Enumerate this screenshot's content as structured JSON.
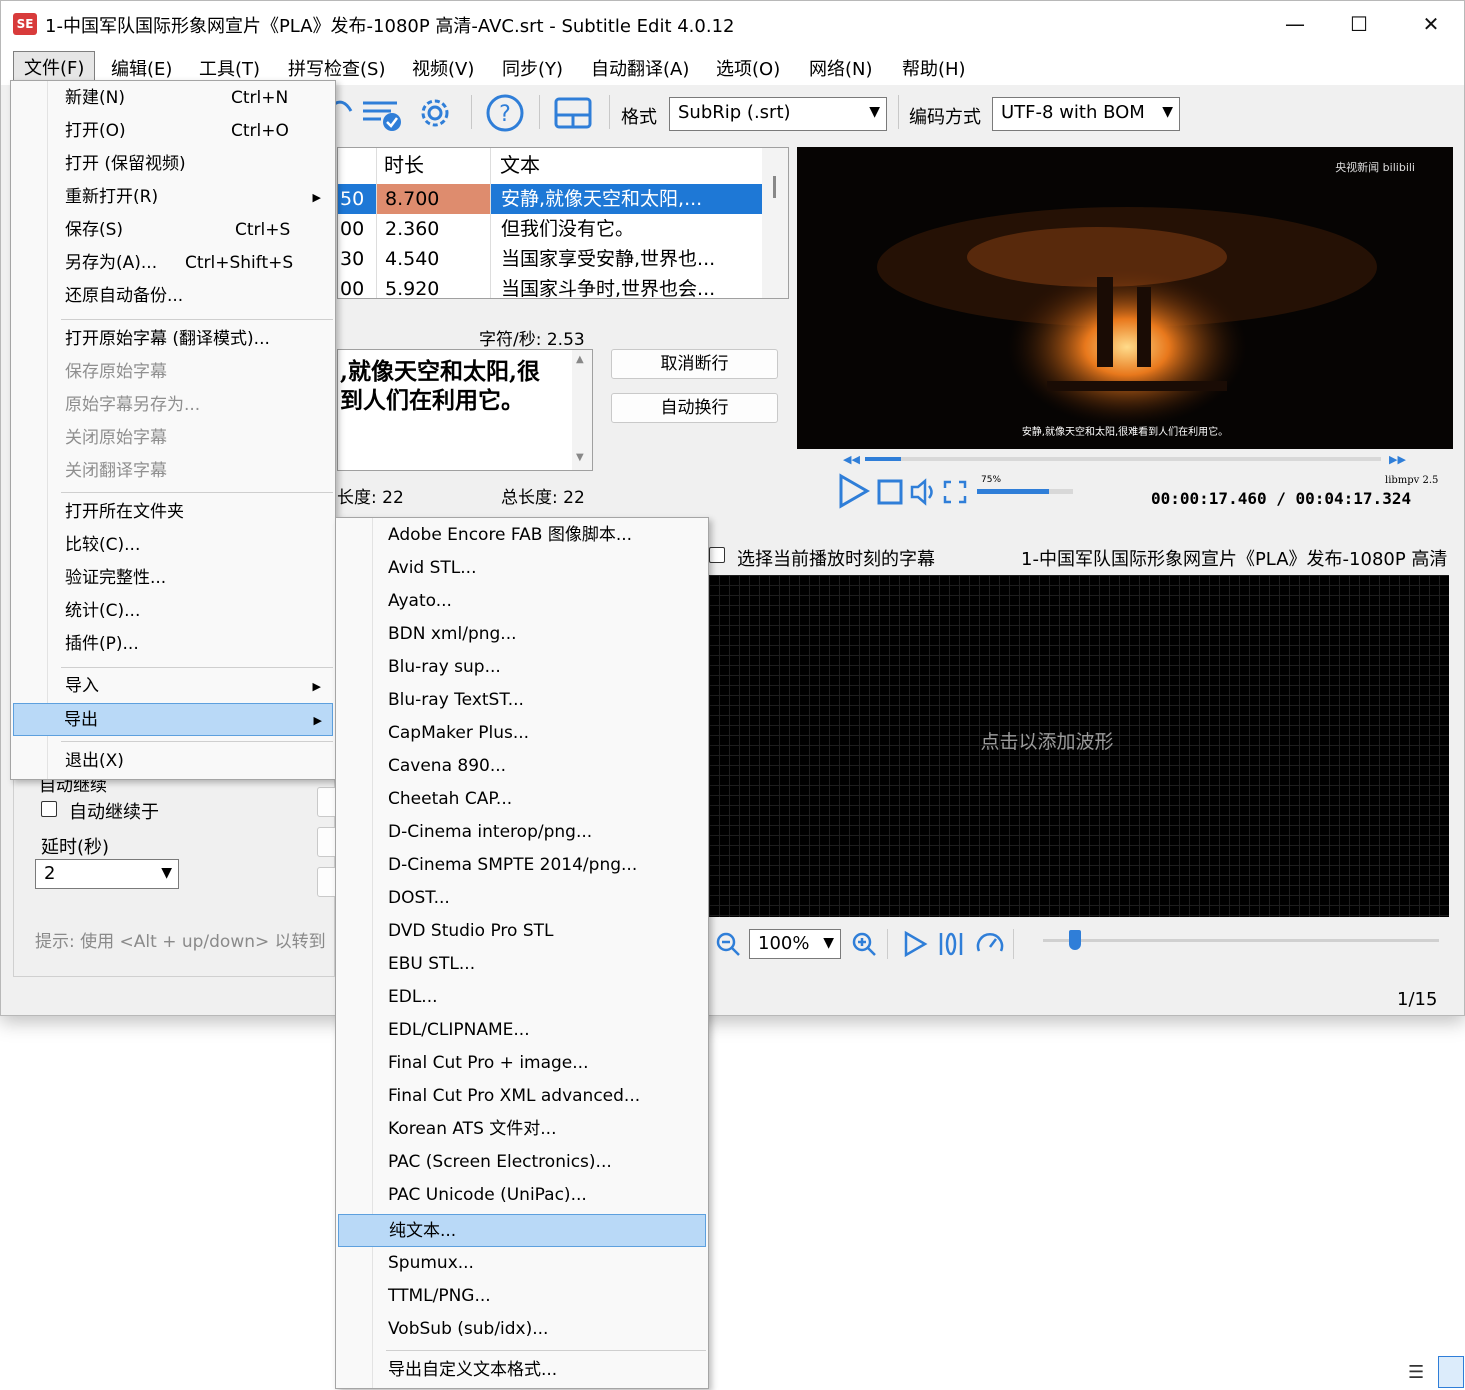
{
  "window": {
    "title": "1-中国军队国际形象网宣片《PLA》发布-1080P 高清-AVC.srt - Subtitle Edit 4.0.12",
    "app_icon": "SE",
    "controls": {
      "minimize": "—",
      "maximize": "☐",
      "close": "✕"
    }
  },
  "menubar": {
    "items": [
      "文件(F)",
      "编辑(E)",
      "工具(T)",
      "拼写检查(S)",
      "视频(V)",
      "同步(Y)",
      "自动翻译(A)",
      "选项(O)",
      "网络(N)",
      "帮助(H)"
    ]
  },
  "toolbar": {
    "format_label": "格式",
    "format_value": "SubRip (.srt)",
    "encoding_label": "编码方式",
    "encoding_value": "UTF-8 with BOM",
    "icons": [
      "visual-sync-icon",
      "spell-check-icon",
      "settings-gear-icon",
      "help-icon",
      "layout-icon"
    ]
  },
  "subtitle_table": {
    "headers": {
      "duration": "时长",
      "text": "文本"
    },
    "rows": [
      {
        "start_frag": "50",
        "duration": "8.700",
        "text": "安静,就像天空和太阳,..."
      },
      {
        "start_frag": "00",
        "duration": "2.360",
        "text": "但我们没有它。"
      },
      {
        "start_frag": "30",
        "duration": "4.540",
        "text": "当国家享受安静,世界也..."
      },
      {
        "start_frag": "00",
        "duration": "5.920",
        "text": "当国家斗争时,世界也会..."
      }
    ],
    "selected_row": 0
  },
  "editor": {
    "chars_per_sec": "字符/秒: 2.53",
    "text_line1": ",就像天空和太阳,很",
    "text_line2": "到人们在利用它。",
    "line_length": "长度: 22",
    "total_length": "总长度: 22",
    "unbreak_button": "取消断行",
    "auto_break_button": "自动换行"
  },
  "video": {
    "logo": "央视新闻 bilibili",
    "caption": "安静,就像天空和太阳,很难看到人们在利用它。",
    "engine": "libmpv 2.5",
    "volume": "75%",
    "volume_level": 0.75,
    "progress": 0.07,
    "time": "00:00:17.460 / 00:04:17.324"
  },
  "waveform": {
    "checkbox_label": "选择当前播放时刻的字幕",
    "file_name": "1-中国军队国际形象网宣片《PLA》发布-1080P 高清",
    "placeholder": "点击以添加波形",
    "zoom": "100%",
    "slider_level": 0.08
  },
  "left_panel": {
    "partial_heading": "自动继续",
    "auto_continue_label": "自动继续于",
    "delay_label": "延时(秒)",
    "delay_value": "2",
    "hint": "提示: 使用 <Alt + up/down> 以转到"
  },
  "status": {
    "position": "1/15"
  },
  "file_menu": {
    "items": [
      {
        "label": "新建(N)",
        "shortcut": "Ctrl+N"
      },
      {
        "label": "打开(O)",
        "shortcut": "Ctrl+O"
      },
      {
        "label": "打开 (保留视频)",
        "shortcut": ""
      },
      {
        "label": "重新打开(R)",
        "shortcut": "",
        "submenu": true
      },
      {
        "label": "保存(S)",
        "shortcut": "Ctrl+S"
      },
      {
        "label": "另存为(A)...",
        "shortcut": "Ctrl+Shift+S"
      },
      {
        "label": "还原自动备份...",
        "shortcut": ""
      },
      {
        "label": "打开原始字幕 (翻译模式)...",
        "shortcut": ""
      },
      {
        "label": "保存原始字幕",
        "shortcut": "",
        "disabled": true
      },
      {
        "label": "原始字幕另存为...",
        "shortcut": "",
        "disabled": true
      },
      {
        "label": "关闭原始字幕",
        "shortcut": "",
        "disabled": true
      },
      {
        "label": "关闭翻译字幕",
        "shortcut": "",
        "disabled": true
      },
      {
        "label": "打开所在文件夹",
        "shortcut": ""
      },
      {
        "label": "比较(C)...",
        "shortcut": ""
      },
      {
        "label": "验证完整性...",
        "shortcut": ""
      },
      {
        "label": "统计(C)...",
        "shortcut": ""
      },
      {
        "label": "插件(P)...",
        "shortcut": ""
      },
      {
        "label": "导入",
        "shortcut": "",
        "submenu": true
      },
      {
        "label": "导出",
        "shortcut": "",
        "submenu": true,
        "highlighted": true
      },
      {
        "label": "退出(X)",
        "shortcut": ""
      }
    ]
  },
  "export_menu": {
    "items": [
      "Adobe Encore FAB 图像脚本...",
      "Avid STL...",
      "Ayato...",
      "BDN xml/png...",
      "Blu-ray sup...",
      "Blu-ray TextST...",
      "CapMaker Plus...",
      "Cavena 890...",
      "Cheetah CAP...",
      "D-Cinema interop/png...",
      "D-Cinema SMPTE 2014/png...",
      "DOST...",
      "DVD Studio Pro STL",
      "EBU STL...",
      "EDL...",
      "EDL/CLIPNAME...",
      "Final Cut Pro + image...",
      "Final Cut Pro XML advanced...",
      "Korean ATS 文件对...",
      "PAC (Screen Electronics)...",
      "PAC Unicode (UniPac)...",
      "纯文本...",
      "Spumux...",
      "TTML/PNG...",
      "VobSub (sub/idx)...",
      "导出自定义文本格式..."
    ],
    "highlighted_index": 21
  },
  "colors": {
    "selection_blue": "#1e78d6",
    "duration_highlight": "#de8c6e",
    "menu_highlight": "#b9d9f7",
    "accent": "#2f7ed8"
  }
}
